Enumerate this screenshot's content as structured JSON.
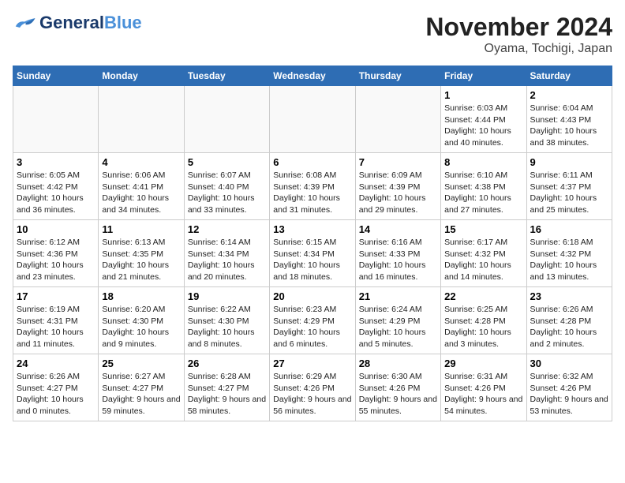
{
  "header": {
    "logo_general": "General",
    "logo_blue": "Blue",
    "month": "November 2024",
    "location": "Oyama, Tochigi, Japan"
  },
  "days_of_week": [
    "Sunday",
    "Monday",
    "Tuesday",
    "Wednesday",
    "Thursday",
    "Friday",
    "Saturday"
  ],
  "weeks": [
    [
      {
        "day": "",
        "info": ""
      },
      {
        "day": "",
        "info": ""
      },
      {
        "day": "",
        "info": ""
      },
      {
        "day": "",
        "info": ""
      },
      {
        "day": "",
        "info": ""
      },
      {
        "day": "1",
        "info": "Sunrise: 6:03 AM\nSunset: 4:44 PM\nDaylight: 10 hours and 40 minutes."
      },
      {
        "day": "2",
        "info": "Sunrise: 6:04 AM\nSunset: 4:43 PM\nDaylight: 10 hours and 38 minutes."
      }
    ],
    [
      {
        "day": "3",
        "info": "Sunrise: 6:05 AM\nSunset: 4:42 PM\nDaylight: 10 hours and 36 minutes."
      },
      {
        "day": "4",
        "info": "Sunrise: 6:06 AM\nSunset: 4:41 PM\nDaylight: 10 hours and 34 minutes."
      },
      {
        "day": "5",
        "info": "Sunrise: 6:07 AM\nSunset: 4:40 PM\nDaylight: 10 hours and 33 minutes."
      },
      {
        "day": "6",
        "info": "Sunrise: 6:08 AM\nSunset: 4:39 PM\nDaylight: 10 hours and 31 minutes."
      },
      {
        "day": "7",
        "info": "Sunrise: 6:09 AM\nSunset: 4:39 PM\nDaylight: 10 hours and 29 minutes."
      },
      {
        "day": "8",
        "info": "Sunrise: 6:10 AM\nSunset: 4:38 PM\nDaylight: 10 hours and 27 minutes."
      },
      {
        "day": "9",
        "info": "Sunrise: 6:11 AM\nSunset: 4:37 PM\nDaylight: 10 hours and 25 minutes."
      }
    ],
    [
      {
        "day": "10",
        "info": "Sunrise: 6:12 AM\nSunset: 4:36 PM\nDaylight: 10 hours and 23 minutes."
      },
      {
        "day": "11",
        "info": "Sunrise: 6:13 AM\nSunset: 4:35 PM\nDaylight: 10 hours and 21 minutes."
      },
      {
        "day": "12",
        "info": "Sunrise: 6:14 AM\nSunset: 4:34 PM\nDaylight: 10 hours and 20 minutes."
      },
      {
        "day": "13",
        "info": "Sunrise: 6:15 AM\nSunset: 4:34 PM\nDaylight: 10 hours and 18 minutes."
      },
      {
        "day": "14",
        "info": "Sunrise: 6:16 AM\nSunset: 4:33 PM\nDaylight: 10 hours and 16 minutes."
      },
      {
        "day": "15",
        "info": "Sunrise: 6:17 AM\nSunset: 4:32 PM\nDaylight: 10 hours and 14 minutes."
      },
      {
        "day": "16",
        "info": "Sunrise: 6:18 AM\nSunset: 4:32 PM\nDaylight: 10 hours and 13 minutes."
      }
    ],
    [
      {
        "day": "17",
        "info": "Sunrise: 6:19 AM\nSunset: 4:31 PM\nDaylight: 10 hours and 11 minutes."
      },
      {
        "day": "18",
        "info": "Sunrise: 6:20 AM\nSunset: 4:30 PM\nDaylight: 10 hours and 9 minutes."
      },
      {
        "day": "19",
        "info": "Sunrise: 6:22 AM\nSunset: 4:30 PM\nDaylight: 10 hours and 8 minutes."
      },
      {
        "day": "20",
        "info": "Sunrise: 6:23 AM\nSunset: 4:29 PM\nDaylight: 10 hours and 6 minutes."
      },
      {
        "day": "21",
        "info": "Sunrise: 6:24 AM\nSunset: 4:29 PM\nDaylight: 10 hours and 5 minutes."
      },
      {
        "day": "22",
        "info": "Sunrise: 6:25 AM\nSunset: 4:28 PM\nDaylight: 10 hours and 3 minutes."
      },
      {
        "day": "23",
        "info": "Sunrise: 6:26 AM\nSunset: 4:28 PM\nDaylight: 10 hours and 2 minutes."
      }
    ],
    [
      {
        "day": "24",
        "info": "Sunrise: 6:26 AM\nSunset: 4:27 PM\nDaylight: 10 hours and 0 minutes."
      },
      {
        "day": "25",
        "info": "Sunrise: 6:27 AM\nSunset: 4:27 PM\nDaylight: 9 hours and 59 minutes."
      },
      {
        "day": "26",
        "info": "Sunrise: 6:28 AM\nSunset: 4:27 PM\nDaylight: 9 hours and 58 minutes."
      },
      {
        "day": "27",
        "info": "Sunrise: 6:29 AM\nSunset: 4:26 PM\nDaylight: 9 hours and 56 minutes."
      },
      {
        "day": "28",
        "info": "Sunrise: 6:30 AM\nSunset: 4:26 PM\nDaylight: 9 hours and 55 minutes."
      },
      {
        "day": "29",
        "info": "Sunrise: 6:31 AM\nSunset: 4:26 PM\nDaylight: 9 hours and 54 minutes."
      },
      {
        "day": "30",
        "info": "Sunrise: 6:32 AM\nSunset: 4:26 PM\nDaylight: 9 hours and 53 minutes."
      }
    ]
  ]
}
